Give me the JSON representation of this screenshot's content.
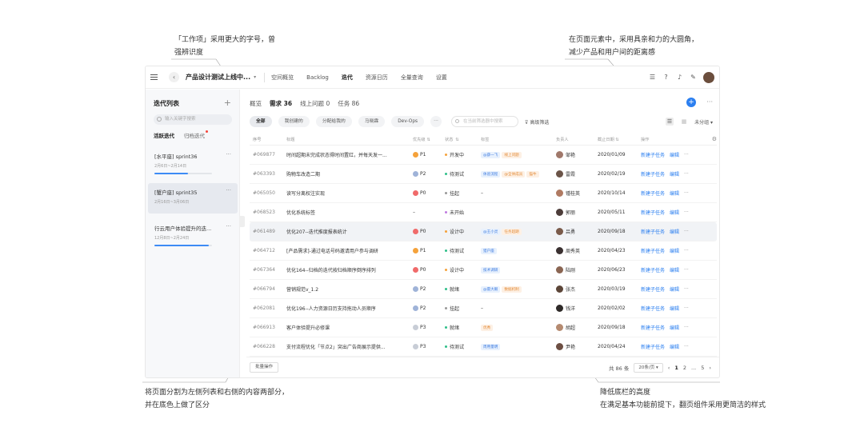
{
  "annotations": {
    "top_left": [
      "「工作项」采用更大的字号，曾",
      "强辨识度"
    ],
    "top_right": [
      "在页面元素中，采用具亲和力的大圆角，",
      "减少产品和用户间的距离感"
    ],
    "bottom_left": [
      "将页面分割为左侧列表和右侧的内容两部分，",
      "并在底色上做了区分"
    ],
    "bottom_right": [
      "降低底栏的高度",
      "在满足基本功能前提下，翻页组件采用更简洁的样式"
    ]
  },
  "topbar": {
    "project_name": "产品设计测试上线中...",
    "nav": [
      "空间概览",
      "Backlog",
      "迭代",
      "资源日历",
      "全量查询",
      "设置"
    ],
    "active_nav": 2
  },
  "sidebar": {
    "title": "迭代列表",
    "search_placeholder": "输入关键字搜索",
    "tabs": [
      "活跃迭代",
      "归档迭代"
    ],
    "items": [
      {
        "name": "[水平座] sprint36",
        "date": "2月6日~2月14日",
        "progress": 0.58
      },
      {
        "name": "[蟹户座] sprint35",
        "date": "2月16日~3月06日",
        "progress": 0.22
      },
      {
        "name": "行云用户体验提升的迭...",
        "date": "12月8日~2月24日",
        "progress": 0.95
      }
    ]
  },
  "main": {
    "tabs": [
      "概览",
      "需求 36",
      "线上问题 0",
      "任务 86"
    ],
    "filters": [
      "全部",
      "我创建的",
      "分配给我的",
      "马晓霖",
      "Dev-Ops"
    ],
    "search_placeholder": "在当前筛选器中搜索",
    "advanced": "高级筛选",
    "group": "未分组",
    "headers": {
      "id": "序号",
      "title": "标题",
      "priority": "优先级",
      "status": "状态",
      "tags": "标签",
      "owner": "负责人",
      "date": "截止日期",
      "ops": "操作"
    },
    "op_labels": {
      "add": "新建子任务",
      "edit": "编辑",
      "more": "···"
    },
    "rows": [
      {
        "id": "#069877",
        "title": "时间超期未完成状态得时间置红，并每天发一...",
        "priority": "P1",
        "pri_color": "#f5a23b",
        "status": "开发中",
        "st_color": "#f5a23b",
        "tags": [
          {
            "t": "@薛一飞",
            "c": "blue"
          },
          {
            "t": "线上问题",
            "c": "orange"
          }
        ],
        "owner": "邹艳",
        "av": "#a0786a",
        "date": "2020/01/09"
      },
      {
        "id": "#063393",
        "title": "购物车改造二期",
        "priority": "P2",
        "pri_color": "#9fb3d8",
        "status": "待测试",
        "st_color": "#2fbf8a",
        "tags": [
          {
            "t": "体验流程",
            "c": "blue"
          },
          {
            "t": "@全体成员",
            "c": "orange"
          },
          {
            "t": "猫牛",
            "c": "orange"
          }
        ],
        "owner": "雷霞",
        "av": "#6b5448",
        "date": "2020/02/19"
      },
      {
        "id": "#065050",
        "title": "读写分离权注实现",
        "priority": "P0",
        "pri_color": "#f06a6a",
        "status": "挂起",
        "st_color": "#999999",
        "tags": [],
        "dash": "–",
        "owner": "锺桂英",
        "av": "#b07a62",
        "date": "2020/10/14"
      },
      {
        "id": "#068523",
        "title": "优化系统标签",
        "priority": "–",
        "pri_color": "",
        "status": "未开始",
        "st_color": "#c07ae0",
        "tags": [],
        "owner": "郭丽",
        "av": "#4d3d3a",
        "date": "2020/05/11"
      },
      {
        "id": "#061489",
        "title": "优化207--迭代推度报表统计",
        "priority": "P0",
        "pri_color": "#f06a6a",
        "status": "设计中",
        "st_color": "#f5a23b",
        "tags": [
          {
            "t": "@王小灵",
            "c": "blue"
          },
          {
            "t": "任务超期",
            "c": "orange"
          }
        ],
        "owner": "吕勇",
        "av": "#7a5a4a",
        "date": "2020/09/18",
        "highlight": true
      },
      {
        "id": "#064712",
        "title": "[产品需求]-通过电话号码邀请用户参与调研",
        "priority": "P1",
        "pri_color": "#f5a23b",
        "status": "待测试",
        "st_color": "#2fbf8a",
        "tags": [
          {
            "t": "猎户座",
            "c": "blue"
          }
        ],
        "owner": "周秀英",
        "av": "#3a3030",
        "date": "2020/04/23"
      },
      {
        "id": "#067364",
        "title": "优化164--归档的迭代按归档顺序倒序排列",
        "priority": "P0",
        "pri_color": "#f06a6a",
        "status": "设计中",
        "st_color": "#f5a23b",
        "tags": [
          {
            "t": "技术调研",
            "c": "blue"
          }
        ],
        "owner": "陆刚",
        "av": "#8a6552",
        "date": "2020/06/23"
      },
      {
        "id": "#066794",
        "title": "营销规范v_1.2",
        "priority": "P2",
        "pri_color": "#9fb3d8",
        "status": "就绪",
        "st_color": "#2fbf8a",
        "tags": [
          {
            "t": "@雷大眼",
            "c": "blue"
          },
          {
            "t": "数据机制",
            "c": "orange"
          }
        ],
        "owner": "张杰",
        "av": "#5c4538",
        "date": "2020/03/19"
      },
      {
        "id": "#062081",
        "title": "优化196--人力资源日历支持拖动人员顺序",
        "priority": "P2",
        "pri_color": "#9fb3d8",
        "status": "挂起",
        "st_color": "#999999",
        "tags": [],
        "dash": "–",
        "owner": "钱洋",
        "av": "#2e2a28",
        "date": "2020/02/02"
      },
      {
        "id": "#066913",
        "title": "客户体验提升必修课",
        "priority": "P3",
        "pri_color": "#c8cdd6",
        "status": "就绪",
        "st_color": "#2fbf8a",
        "tags": [
          {
            "t": "优秀",
            "c": "orange"
          }
        ],
        "owner": "胡超",
        "av": "#b58a70",
        "date": "2020/09/18"
      },
      {
        "id": "#066228",
        "title": "支付流程优化「节点2」突出广告商展示提供...",
        "priority": "P3",
        "pri_color": "#c8cdd6",
        "status": "待测试",
        "st_color": "#2fbf8a",
        "tags": [
          {
            "t": "周用量明",
            "c": "blue"
          }
        ],
        "owner": "尹艳",
        "av": "#6d4f43",
        "date": "2020/04/24"
      }
    ],
    "footer": {
      "batch": "批量操作",
      "total": "共 86 条",
      "page_size": "20条/页",
      "pages": [
        "1",
        "2",
        "...",
        "5"
      ]
    }
  }
}
